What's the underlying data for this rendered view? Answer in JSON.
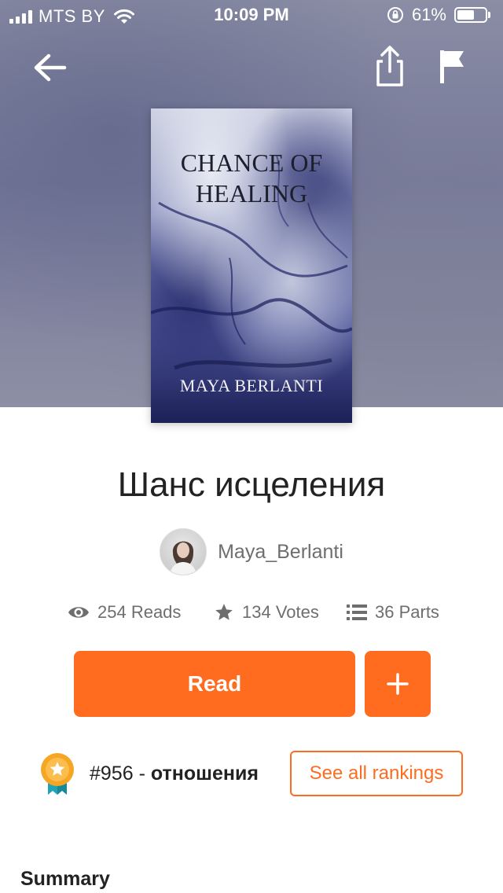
{
  "status_bar": {
    "carrier": "MTS BY",
    "time": "10:09 PM",
    "battery_percent": "61%",
    "battery_level": 0.61,
    "icons": [
      "signal-icon",
      "wifi-icon",
      "orientation-lock-icon",
      "battery-icon"
    ]
  },
  "nav": {
    "icons": [
      "back-arrow-icon",
      "share-icon",
      "flag-icon"
    ]
  },
  "cover": {
    "title_lines": [
      "CHANCE OF",
      "HEALING"
    ],
    "author": "MAYA BERLANTI"
  },
  "story": {
    "title": "Шанс исцеления",
    "author": "Maya_Berlanti",
    "reads": "254 Reads",
    "votes": "134 Votes",
    "parts": "36 Parts"
  },
  "actions": {
    "read_label": "Read",
    "add_label": "+"
  },
  "ranking": {
    "rank": "#956",
    "separator": " - ",
    "category": "отношения",
    "see_all_label": "See all rankings"
  },
  "summary": {
    "heading": "Summary"
  },
  "colors": {
    "accent": "#ff6c1f",
    "badge_gold": "#f5a623",
    "badge_ribbon": "#1fa3b5",
    "text_primary": "#222222",
    "text_secondary": "#6e6e6e"
  }
}
